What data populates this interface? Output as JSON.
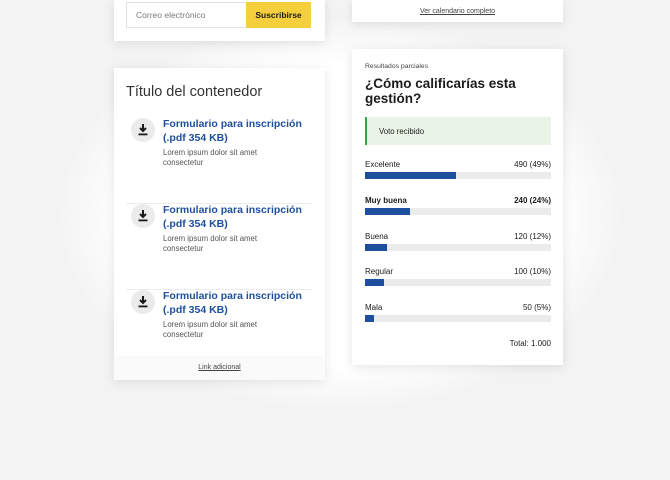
{
  "subscribe": {
    "email_placeholder": "Correo electrónico",
    "button_label": "Suscribirse"
  },
  "calendar": {
    "link_label": "Ver calendario completo"
  },
  "container": {
    "title": "Título del contenedor",
    "items": [
      {
        "title": "Formulario para inscripción (.pdf 354 KB)",
        "description": "Lorem ipsum dolor sit amet consectetur",
        "icon": "download-icon"
      },
      {
        "title": "Formulario para inscripción (.pdf 354 KB)",
        "description": "Lorem ipsum dolor sit amet consectetur",
        "icon": "download-icon"
      },
      {
        "title": "Formulario para inscripción (.pdf 354 KB)",
        "description": "Lorem ipsum dolor sit amet consectetur",
        "icon": "download-icon"
      }
    ],
    "extra_link": "Link adicional"
  },
  "poll": {
    "overline": "Resultados parciales",
    "question": "¿Cómo calificarías esta gestión?",
    "alert": "Voto recibido",
    "options": [
      {
        "label": "Excelente",
        "value": "490 (49%)",
        "percent": 49,
        "selected": false
      },
      {
        "label": "Muy buena",
        "value": "240 (24%)",
        "percent": 24,
        "selected": true
      },
      {
        "label": "Buena",
        "value": "120 (12%)",
        "percent": 12,
        "selected": false
      },
      {
        "label": "Regular",
        "value": "100 (10%)",
        "percent": 10,
        "selected": false
      },
      {
        "label": "Mala",
        "value": "50 (5%)",
        "percent": 5,
        "selected": false
      }
    ],
    "total": "Total: 1.000"
  },
  "colors": {
    "accent_blue": "#1d4f9e",
    "button_yellow": "#f6cf3c",
    "alert_green": "#3aa24a",
    "alert_bg": "#e9f4e7"
  }
}
